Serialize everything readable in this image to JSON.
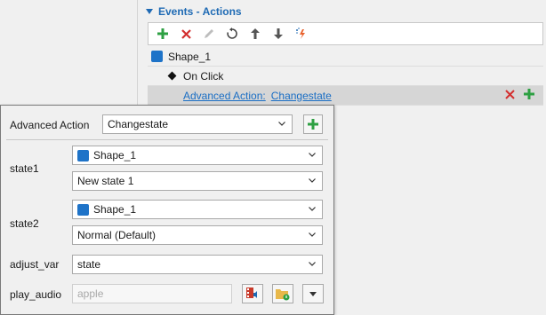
{
  "events_panel": {
    "header": "Events - Actions",
    "toolbar": {
      "icons": [
        "add-icon",
        "delete-icon",
        "edit-icon",
        "reset-icon",
        "move-up-icon",
        "move-down-icon",
        "magic-icon"
      ]
    },
    "tree": {
      "shape_label": "Shape_1",
      "event_label": "On Click",
      "action_prefix": "Advanced Action:",
      "action_name": "Changestate"
    }
  },
  "popup": {
    "advanced_action_label": "Advanced Action",
    "advanced_action_value": "Changestate",
    "state1": {
      "label": "state1",
      "shape_value": "Shape_1",
      "state_value": "New state 1"
    },
    "state2": {
      "label": "state2",
      "shape_value": "Shape_1",
      "state_value": "Normal (Default)"
    },
    "adjust_var": {
      "label": "adjust_var",
      "value": "state"
    },
    "play_audio": {
      "label": "play_audio",
      "placeholder": "apple"
    }
  },
  "colors": {
    "accent": "#1e6ab4",
    "shape_blue": "#1e73c8",
    "add_green": "#2ea043",
    "delete_red": "#d32f2f"
  }
}
